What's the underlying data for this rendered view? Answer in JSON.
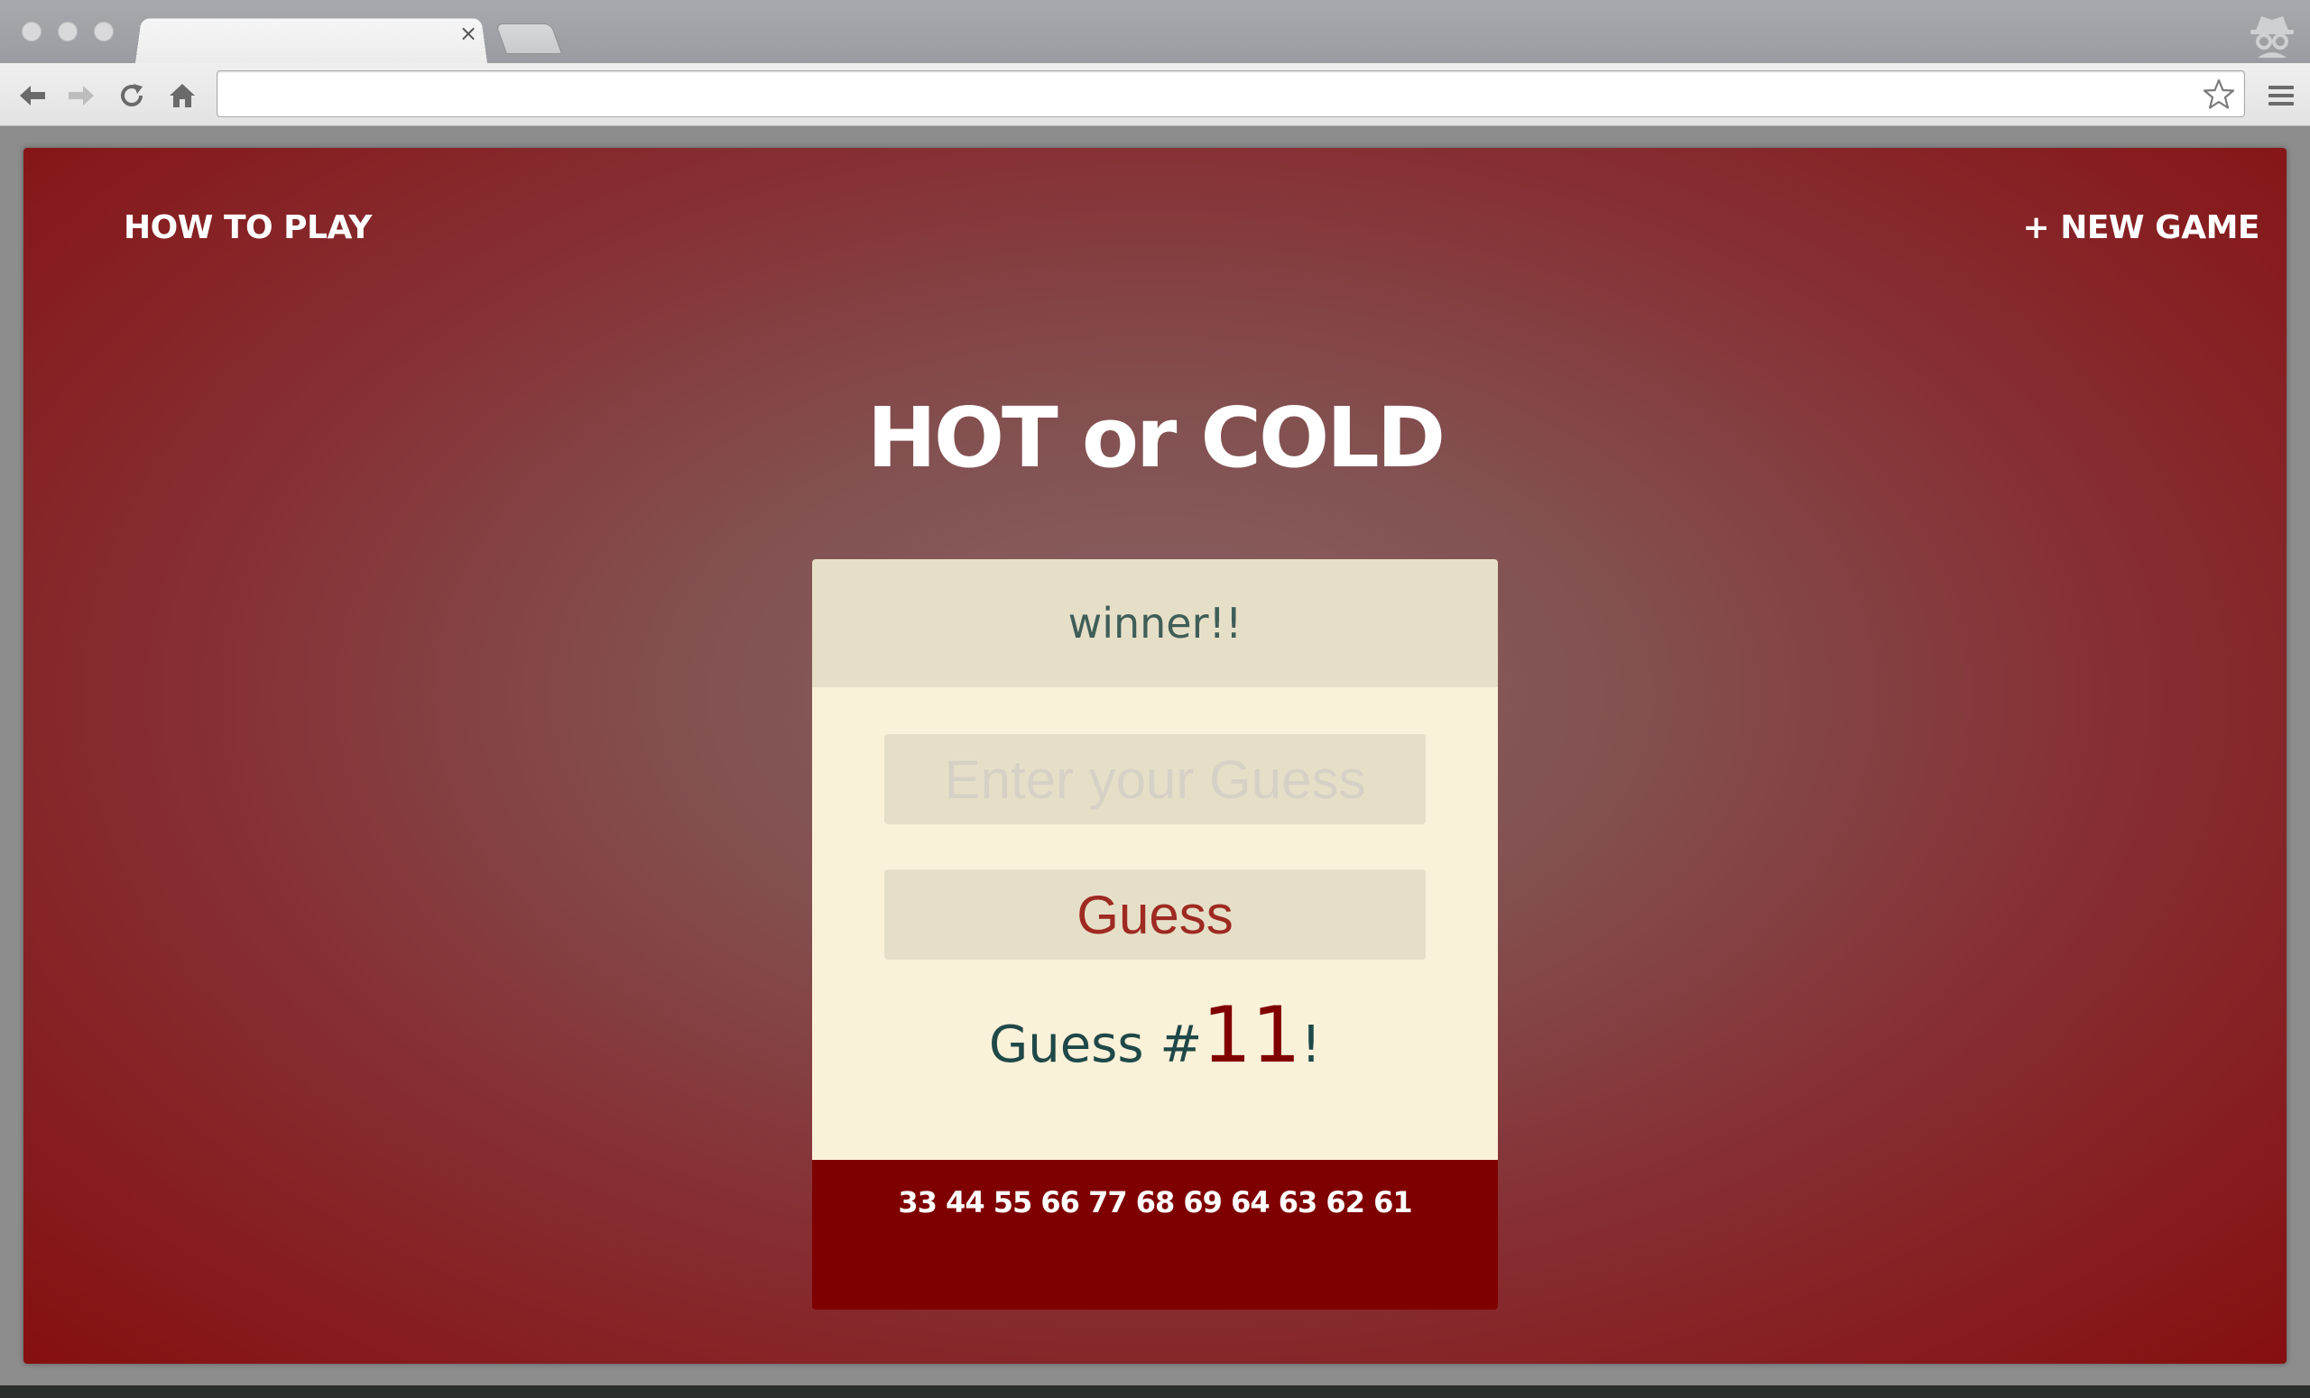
{
  "browser": {
    "active_tab_title": "",
    "address_bar_value": "",
    "close_glyph": "×",
    "icons": [
      "back-arrow-icon",
      "forward-arrow-icon",
      "reload-icon",
      "home-icon",
      "bookmark-star-icon",
      "menu-icon",
      "incognito-icon"
    ]
  },
  "nav": {
    "how_to_play": "HOW TO PLAY",
    "new_game": "+ NEW GAME"
  },
  "game": {
    "title": "HOT or COLD",
    "feedback": "winner!!",
    "input_placeholder": "Enter your Guess",
    "input_value": "",
    "guess_button_label": "Guess",
    "count_prefix": "Guess #",
    "count_value": "11",
    "count_suffix": "!",
    "previous_guesses": "33 44 55 66 77 68 69 64 63 62 61"
  },
  "colors": {
    "background_edge": "#860f10",
    "background_center": "#8a6464",
    "card_header": "#e6dfc8",
    "card_body": "#faf1d9",
    "card_footer": "#7f0000",
    "button_text": "#9e2a22",
    "count_number": "#800000",
    "count_text": "#1f4848",
    "feedback_text": "#3f5e58"
  }
}
